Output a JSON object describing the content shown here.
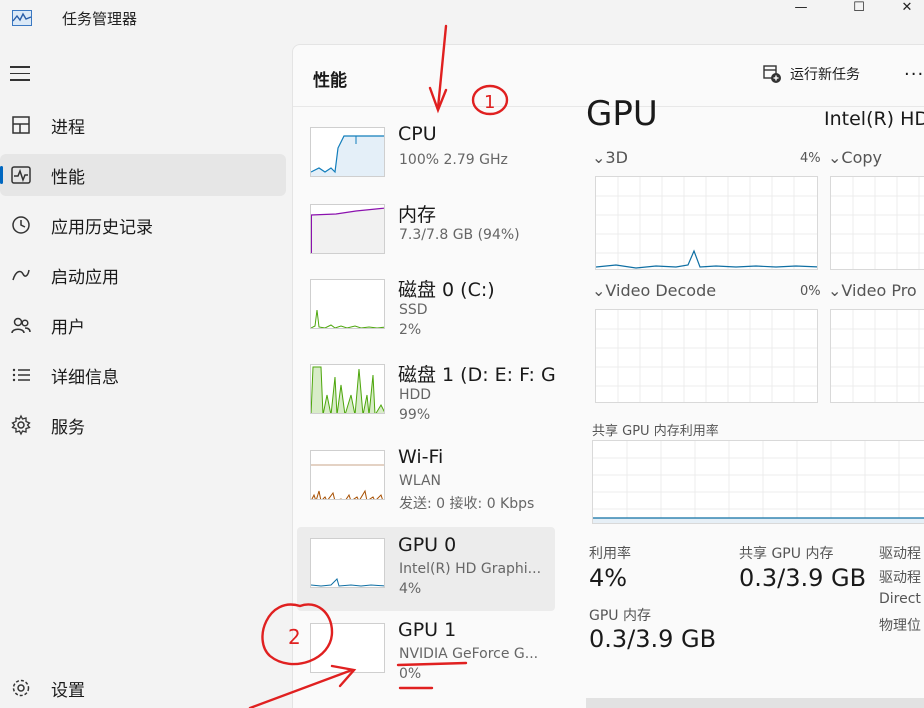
{
  "titlebar": {
    "title": "任务管理器",
    "minimize": "—",
    "maximize": "☐",
    "close": "✕"
  },
  "nav": {
    "items": [
      {
        "label": "进程",
        "icon": "processes-icon"
      },
      {
        "label": "性能",
        "icon": "performance-icon",
        "active": true
      },
      {
        "label": "应用历史记录",
        "icon": "app-history-icon"
      },
      {
        "label": "启动应用",
        "icon": "startup-apps-icon"
      },
      {
        "label": "用户",
        "icon": "users-icon"
      },
      {
        "label": "详细信息",
        "icon": "details-icon"
      },
      {
        "label": "服务",
        "icon": "services-icon"
      }
    ],
    "settings": "设置"
  },
  "header": {
    "title": "性能",
    "run_task": "运行新任务",
    "more": "···"
  },
  "devices": [
    {
      "name": "CPU",
      "sub1": "100% 2.79 GHz"
    },
    {
      "name": "内存",
      "sub1": "7.3/7.8 GB (94%)"
    },
    {
      "name": "磁盘 0 (C:)",
      "sub1": "SSD",
      "sub2": "2%"
    },
    {
      "name": "磁盘 1 (D: E: F: G",
      "sub1": "HDD",
      "sub2": "99%"
    },
    {
      "name": "Wi-Fi",
      "sub1": "WLAN",
      "sub2": "发送: 0 接收: 0 Kbps"
    },
    {
      "name": "GPU 0",
      "sub1": "Intel(R) HD Graphi...",
      "sub2": "4%",
      "selected": true
    },
    {
      "name": "GPU 1",
      "sub1": "NVIDIA GeForce G...",
      "sub2": "0%"
    }
  ],
  "gpu": {
    "title": "GPU",
    "model": "Intel(R) HD",
    "engines": [
      {
        "label": "3D",
        "pct": "4%"
      },
      {
        "label": "Copy",
        "pct": ""
      },
      {
        "label": "Video Decode",
        "pct": "0%"
      },
      {
        "label": "Video Pro",
        "pct": ""
      }
    ],
    "shared_label": "共享 GPU 内存利用率",
    "stats": {
      "util_label": "利用率",
      "util_value": "4%",
      "shared_label": "共享 GPU 内存",
      "shared_value": "0.3/3.9 GB",
      "mem_label": "GPU 内存",
      "mem_value": "0.3/3.9 GB"
    },
    "side_labels": [
      "驱动程",
      "驱动程",
      "Direct",
      "物理位"
    ]
  },
  "annotations": {
    "mark1": "1",
    "mark2": "2"
  },
  "colors": {
    "cpu": "#117dbb",
    "memory": "#8b12ae",
    "disk": "#4da60c",
    "wifi": "#a74f01",
    "gpu": "#0f6fa3",
    "annotation": "#e02020"
  }
}
